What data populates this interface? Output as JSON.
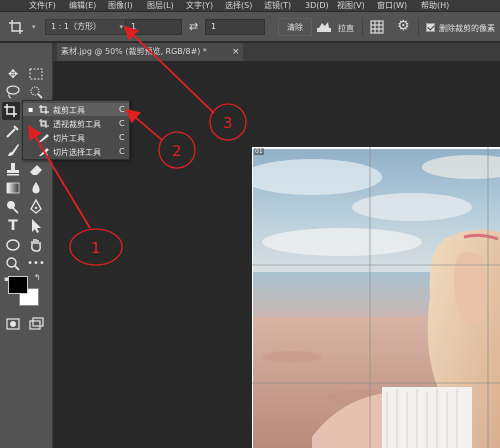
{
  "menubar": {
    "items": [
      "文件(F)",
      "编辑(E)",
      "图像(I)",
      "图层(L)",
      "文字(Y)",
      "选择(S)",
      "滤镜(T)",
      "3D(D)",
      "视图(V)",
      "窗口(W)",
      "帮助(H)"
    ]
  },
  "options_bar": {
    "ratio_select": "1 : 1（方形）",
    "width_value": "1",
    "height_value": "1",
    "clear_label": "清除",
    "straighten_label": "拉直",
    "delete_cropped_label": "删除裁剪的像素",
    "delete_cropped_checked": true
  },
  "document": {
    "tab_title": "素材.jpg @ 50% (裁剪预览, RGB/8#) *",
    "tab_close": "×",
    "crop_label": "01"
  },
  "tool_flyout": {
    "items": [
      {
        "label": "裁剪工具",
        "shortcut": "C",
        "selected": true
      },
      {
        "label": "透视裁剪工具",
        "shortcut": "C",
        "selected": false
      },
      {
        "label": "切片工具",
        "shortcut": "C",
        "selected": false
      },
      {
        "label": "切片选择工具",
        "shortcut": "C",
        "selected": false
      }
    ]
  },
  "annotations": {
    "labels": [
      "1",
      "2",
      "3"
    ],
    "color": "#e02020"
  },
  "colors": {
    "foreground": "#000000",
    "background": "#ffffff"
  }
}
